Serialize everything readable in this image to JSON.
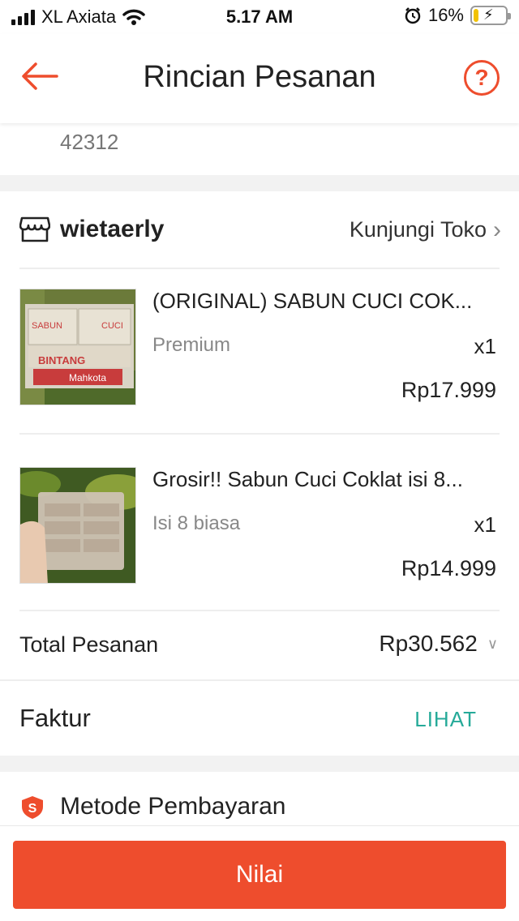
{
  "status_bar": {
    "carrier": "XL Axiata",
    "time": "5.17 AM",
    "battery": "16%",
    "battery_level": 0.16
  },
  "header": {
    "title": "Rincian Pesanan",
    "help_label": "?"
  },
  "address": {
    "postal_code": "42312"
  },
  "shop": {
    "name": "wietaerly",
    "visit_label": "Kunjungi Toko",
    "items": [
      {
        "name": "(ORIGINAL) SABUN CUCI COK...",
        "variant": "Premium",
        "qty": "x1",
        "price": "Rp17.999",
        "thumb_text": {
          "l1": "SABUN",
          "l2": "CUCI",
          "l3": "BINTANG",
          "l4": "Mahkota"
        }
      },
      {
        "name": "Grosir!! Sabun Cuci Coklat isi 8...",
        "variant": "Isi 8 biasa",
        "qty": "x1",
        "price": "Rp14.999"
      }
    ],
    "total_label": "Total Pesanan",
    "total_value": "Rp30.562",
    "invoice_label": "Faktur",
    "invoice_link": "LIHAT"
  },
  "payment": {
    "title": "Metode Pembayaran",
    "icon_letter": "S"
  },
  "bottom": {
    "rate_button": "Nilai"
  },
  "colors": {
    "accent": "#ee4d2d",
    "link_teal": "#26aa99"
  }
}
